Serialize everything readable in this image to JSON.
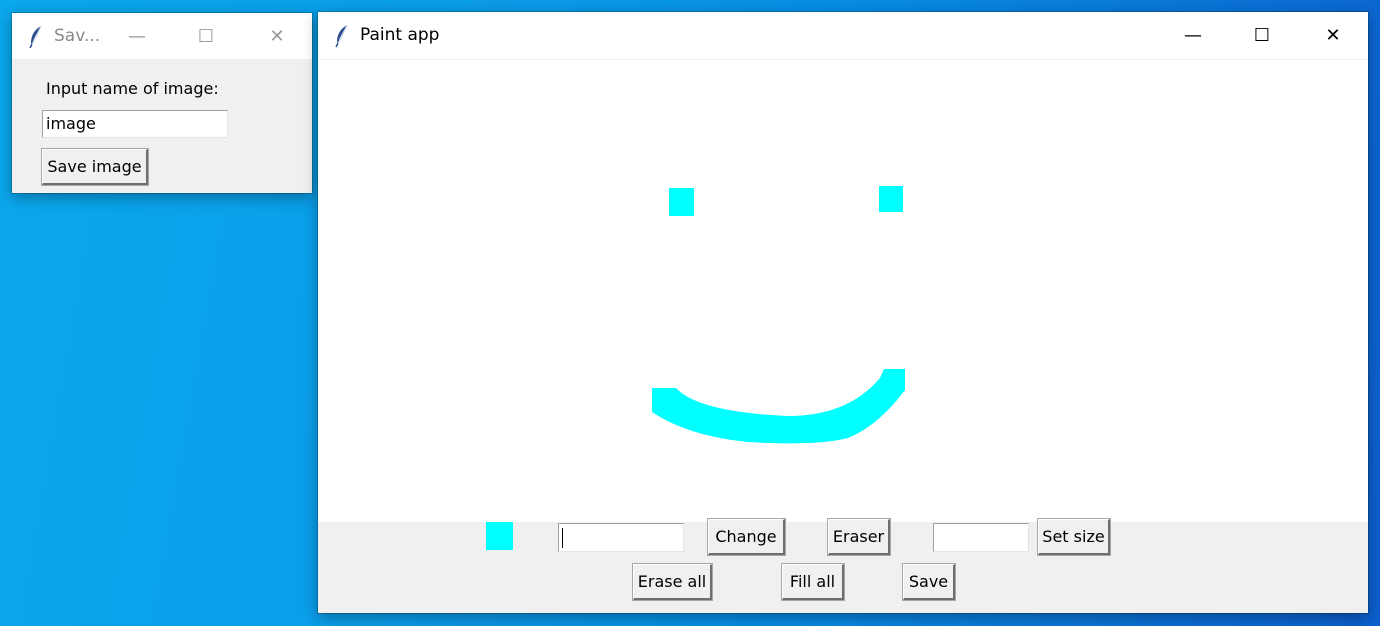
{
  "save_dialog": {
    "title": "Sav...",
    "minimize_glyph": "—",
    "maximize_glyph": "☐",
    "close_glyph": "✕",
    "prompt_label": "Input name of image:",
    "name_input_value": "image",
    "save_button_label": "Save image"
  },
  "paint_window": {
    "title": "Paint app",
    "minimize_glyph": "—",
    "maximize_glyph": "☐",
    "close_glyph": "✕",
    "canvas_background": "#ffffff",
    "brush_color": "#00ffff",
    "toolbar": {
      "color_input_value": "",
      "change_label": "Change",
      "eraser_label": "Eraser",
      "size_input_value": "",
      "set_size_label": "Set size",
      "erase_all_label": "Erase all",
      "fill_all_label": "Fill all",
      "save_label": "Save"
    }
  }
}
